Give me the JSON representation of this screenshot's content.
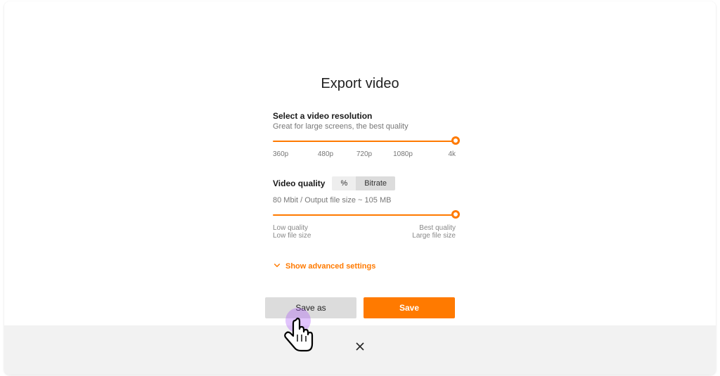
{
  "title": "Export video",
  "resolution": {
    "heading": "Select a video resolution",
    "subtitle": "Great for large screens, the best quality",
    "ticks": [
      "360p",
      "480p",
      "720p",
      "1080p",
      "4k"
    ],
    "value_index": 4
  },
  "quality": {
    "heading": "Video quality",
    "mode_percent": "%",
    "mode_bitrate": "Bitrate",
    "active_mode": "Bitrate",
    "readout": "80 Mbit / Output file size ~ 105 MB",
    "low1": "Low quality",
    "low2": "Low file size",
    "high1": "Best quality",
    "high2": "Large file size",
    "value_percent": 100
  },
  "advanced_label": "Show advanced settings",
  "buttons": {
    "save_as": "Save as",
    "save": "Save"
  },
  "colors": {
    "accent": "#ff7a00"
  }
}
